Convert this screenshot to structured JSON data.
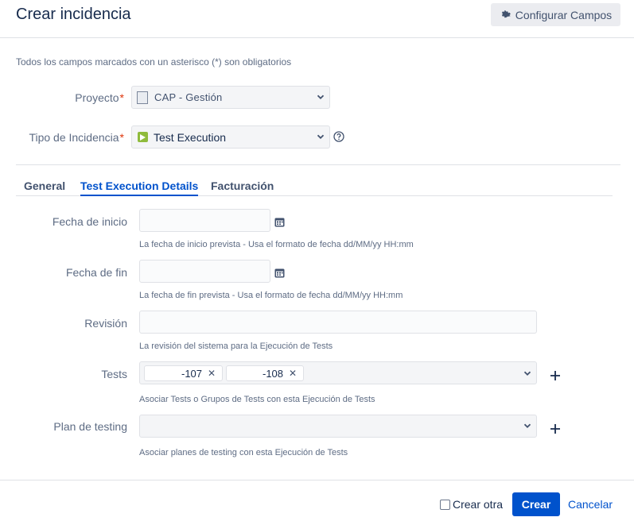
{
  "header": {
    "title": "Crear incidencia",
    "configure_button": "Configurar Campos"
  },
  "form": {
    "required_note": "Todos los campos marcados con un asterisco (*) son obligatorios",
    "project": {
      "label": "Proyecto",
      "value": "CAP - Gestión",
      "required_mark": "*"
    },
    "issue_type": {
      "label": "Tipo de Incidencia",
      "value": "Test Execution",
      "required_mark": "*"
    }
  },
  "tabs": [
    {
      "label": "General"
    },
    {
      "label": "Test Execution Details"
    },
    {
      "label": "Facturación"
    }
  ],
  "fields": {
    "start_date": {
      "label": "Fecha de inicio",
      "value": "",
      "hint": "La fecha de inicio prevista - Usa el formato de fecha dd/MM/yy HH:mm"
    },
    "end_date": {
      "label": "Fecha de fin",
      "value": "",
      "hint": "La fecha de fin prevista - Usa el formato de fecha dd/MM/yy HH:mm"
    },
    "revision": {
      "label": "Revisión",
      "value": "",
      "hint": "La revisión del sistema para la Ejecución de Tests"
    },
    "tests": {
      "label": "Tests",
      "chips": [
        "-107",
        "-108"
      ],
      "hint": "Asociar Tests o Grupos de Tests con esta Ejecución de Tests"
    },
    "test_plan": {
      "label": "Plan de testing",
      "value": "",
      "hint": "Asociar planes de testing con esta Ejecución de Tests"
    }
  },
  "footer": {
    "create_another": "Crear otra",
    "create_button": "Crear",
    "cancel_link": "Cancelar"
  },
  "colors": {
    "primary": "#0052cc",
    "required": "#de350b",
    "test_execution_icon": "#8fbb3c"
  }
}
